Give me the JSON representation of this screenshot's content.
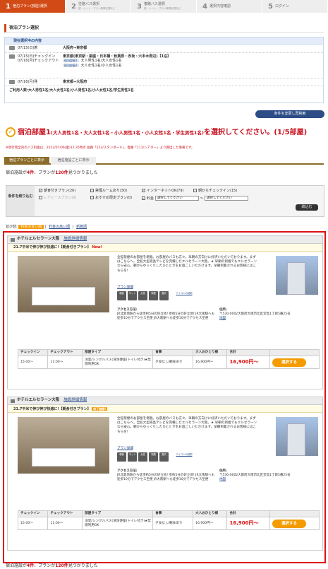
{
  "steps": [
    {
      "num": "1",
      "label": "宿泊プラン(部屋)選択",
      "sub": "",
      "active": true
    },
    {
      "num": "2",
      "label": "往路バス選択",
      "sub": "便・シート・プラン乗車区間など",
      "active": false
    },
    {
      "num": "3",
      "label": "復路バス選択",
      "sub": "便・シート・プラン乗車区間など",
      "active": false
    },
    {
      "num": "4",
      "label": "選択内容確認",
      "sub": "",
      "active": false
    },
    {
      "num": "5",
      "label": "ログイン",
      "sub": "",
      "active": false
    }
  ],
  "section_title": "宿泊プラン選択",
  "current": {
    "head": "現在選択中の内容",
    "rows": [
      {
        "date": "07/15(日)着",
        "value": "大阪府→東京都"
      },
      {
        "date": "07/15(日)チェックイン\n07/16(月)チェックアウト",
        "value": "東京都(東京駅・銀座・日本橋・秋葉原・赤坂・六本木周辺)【1泊】",
        "lines": [
          {
            "tag": "宿泊部屋1",
            "text": "大人男性1名/大人女性1名"
          },
          {
            "tag": "宿泊部屋2",
            "text": "大人女性1名/小人女性1名"
          }
        ]
      },
      {
        "date": "07/16(月)発",
        "value": "東京都→大阪府"
      }
    ],
    "guests": "ご利用人数:大人男性1名/大人女性1名/小人男性1名/小人女性1名/学生男性1名"
  },
  "change_button": "条件を変更し再検索",
  "headline": {
    "room": "宿泊部屋1",
    "people": "(大人男性1名・大人女性1名・小人男性1名・小人女性1名・学生男性1名)",
    "tail": "を選択してください。(1/5部屋)"
  },
  "note": "※現行完全内のバス料金は、2012/07/06(金)12:35時点 往路「223/スタンダード」、復路「111/シアター」より算出した価格です。",
  "tabs": [
    "宿泊プランごとに表示",
    "宿泊施設ごとに表示"
  ],
  "count": {
    "pre": "宿泊施設が",
    "a": "4件",
    "mid": "、プランが",
    "b": "120件",
    "post": "見つかりました"
  },
  "filter": {
    "label": "条件を絞り込む",
    "options": [
      "朝食付きプラン(26)",
      "禁煙ルームあり(30)",
      "インターネットOK(79)",
      "朝からチェックイン(15)",
      "レディースプラン(0)",
      "おすすめ限定プラン(0)"
    ],
    "price_label": "料金",
    "price_from": "選択してください",
    "price_to": "選択してください",
    "button": "絞込む"
  },
  "sort": {
    "label": "並び替:",
    "options": [
      "料金の安い順",
      "料金の高い順",
      "新着順"
    ]
  },
  "hotels": [
    {
      "name": "ホテルエルセラーン大阪",
      "detail_link": "施設詳細情報",
      "plan": "21.7平米で伸び伸び快適に!【朝食付きプラン】",
      "badge": "New!",
      "desc": "全館禁煙のお部屋を堪能。お部屋のバスも広々。早朝の方向けに好評いただいております。まずはこちらへ。全館大型液晶テレビを完備したエルセラーン大阪。★ 早朝の到着でもエルセラーンなら安心。朝からゆっくりしたひとときをお過ごしいただけます。早朝到着されるお客様にはこちらを!",
      "plan_link": "プラン詳細",
      "amen_link": "アイコンの説明",
      "amen": [
        "朝食",
        "ネット",
        "女性",
        "喫煙",
        "露天"
      ],
      "access_label": "アクセス方法:",
      "access": "JR北新地駅から徒歩約5分の好立地! 歩約5分の好立地! JR大阪駅へも徒歩10分でアクセス至便 JR大阪駅へも徒歩10分でアクセス至便",
      "addr_label": "住所:",
      "addr": "〒530-0002大阪府大阪市北区堂島1丁目5番25号",
      "map": "地図",
      "cols": [
        "チェックイン",
        "チェックアウト",
        "部屋タイプ",
        "食事",
        "大人おひとり様",
        "合計"
      ],
      "row": [
        "15:00〜",
        "11:00〜",
        "洋室/シングルバス(洗浄便座)トイレ付き)★禁煙利用OK",
        "夕食なし/朝食あり",
        "16,900円〜",
        "16,900円〜"
      ],
      "reserve": "選択する"
    },
    {
      "name": "ホテルエルセラーン大阪",
      "detail_link": "施設詳細情報",
      "plan": "21.7平米で伸び伸び快適に!【朝食付きプラン】",
      "badge": "終了間際!",
      "desc": "全館禁煙のお部屋を堪能。お部屋のバスも広々。早朝の方向けに好評いただいております。まずはこちらへ。全館大型液晶テレビを完備したエルセラーン大阪。★ 早朝の到着でもエルセラーンなら安心。朝からゆっくりしたひとときをお過ごしいただけます。早朝到着されるお客様にはこちらを!",
      "plan_link": "プラン詳細",
      "amen_link": "アイコンの説明",
      "amen": [
        "朝食",
        "ネット",
        "女性",
        "喫煙",
        "露天"
      ],
      "access_label": "アクセス方法:",
      "access": "JR北新地駅から徒歩約5分の好立地! 歩約5分の好立地! JR大阪駅へも徒歩10分でアクセス至便 JR大阪駅へも徒歩10分でアクセス至便",
      "addr_label": "住所:",
      "addr": "〒530-0002大阪府大阪市北区堂島1丁目5番25号",
      "map": "地図",
      "cols": [
        "チェックイン",
        "チェックアウト",
        "部屋タイプ",
        "食事",
        "大人おひとり様",
        "合計"
      ],
      "row": [
        "15:00〜",
        "11:00〜",
        "洋室/シングルバス(洗浄便座)トイレ付き)★禁煙利用OK",
        "夕食なし/朝食あり",
        "16,900円〜",
        "16,900円〜"
      ],
      "reserve": "選択する"
    }
  ]
}
